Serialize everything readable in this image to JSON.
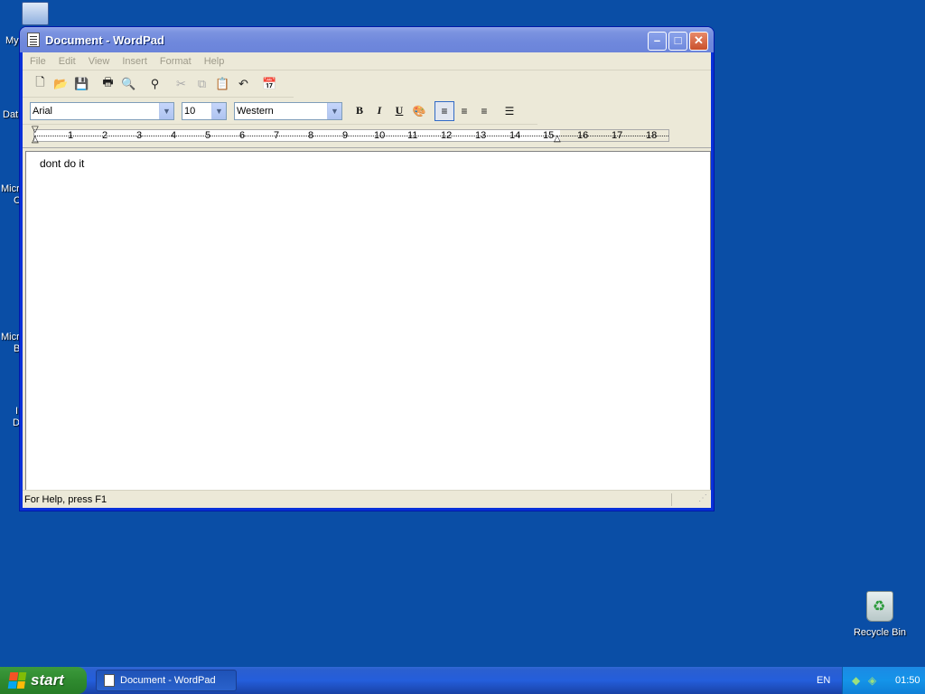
{
  "desktop": {
    "partial_labels": [
      "My",
      "Dat",
      "Micro",
      "C",
      "Micro",
      "B",
      "I",
      "D"
    ],
    "recycle_bin_label": "Recycle Bin"
  },
  "window": {
    "title": "Document - WordPad",
    "controls": {
      "minimize": "–",
      "maximize": "□",
      "close": "✕"
    }
  },
  "menu": {
    "items": [
      "File",
      "Edit",
      "View",
      "Insert",
      "Format",
      "Help"
    ]
  },
  "toolbar": {
    "icons": [
      "new-icon",
      "open-icon",
      "save-icon",
      "print-icon",
      "print-preview-icon",
      "find-icon",
      "cut-icon",
      "copy-icon",
      "paste-icon",
      "undo-icon",
      "date-time-icon"
    ]
  },
  "format": {
    "font": "Arial",
    "size": "10",
    "script": "Western",
    "bold": "B",
    "italic": "I",
    "underline": "U"
  },
  "ruler": {
    "numbers": [
      "1",
      "2",
      "3",
      "4",
      "5",
      "6",
      "7",
      "8",
      "9",
      "10",
      "11",
      "12",
      "13",
      "14",
      "15",
      "16",
      "17",
      "18"
    ]
  },
  "document": {
    "text": "dont do it"
  },
  "status": {
    "help_text": "For Help, press F1"
  },
  "taskbar": {
    "start_label": "start",
    "task_button": "Document - WordPad",
    "language": "EN",
    "clock": "01:50"
  }
}
